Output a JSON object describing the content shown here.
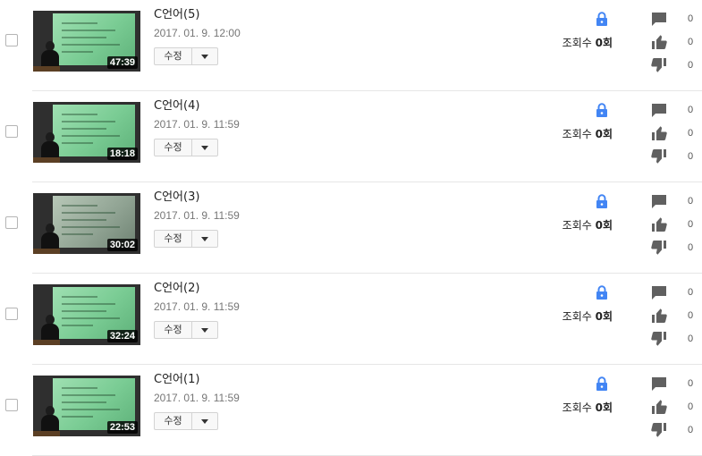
{
  "videos": [
    {
      "title": "C언어(5)",
      "date": "2017. 01. 9. 12:00",
      "duration": "47:39",
      "views_label": "조회수 ",
      "views_count": "0회",
      "comments": "0",
      "likes": "0",
      "dislikes": "0"
    },
    {
      "title": "C언어(4)",
      "date": "2017. 01. 9. 11:59",
      "duration": "18:18",
      "views_label": "조회수 ",
      "views_count": "0회",
      "comments": "0",
      "likes": "0",
      "dislikes": "0"
    },
    {
      "title": "C언어(3)",
      "date": "2017. 01. 9. 11:59",
      "duration": "30:02",
      "views_label": "조회수 ",
      "views_count": "0회",
      "comments": "0",
      "likes": "0",
      "dislikes": "0"
    },
    {
      "title": "C언어(2)",
      "date": "2017. 01. 9. 11:59",
      "duration": "32:24",
      "views_label": "조회수 ",
      "views_count": "0회",
      "comments": "0",
      "likes": "0",
      "dislikes": "0"
    },
    {
      "title": "C언어(1)",
      "date": "2017. 01. 9. 11:59",
      "duration": "22:53",
      "views_label": "조회수 ",
      "views_count": "0회",
      "comments": "0",
      "likes": "0",
      "dislikes": "0"
    }
  ],
  "edit_label": "수정",
  "colors": {
    "lock": "#4285f4",
    "icon": "#606060",
    "count": "#555555",
    "date": "#767676"
  },
  "icons": {
    "privacy": "lock-icon",
    "comments": "comment-icon",
    "likes": "thumbs-up-icon",
    "dislikes": "thumbs-down-icon",
    "menu": "chevron-down-icon"
  }
}
